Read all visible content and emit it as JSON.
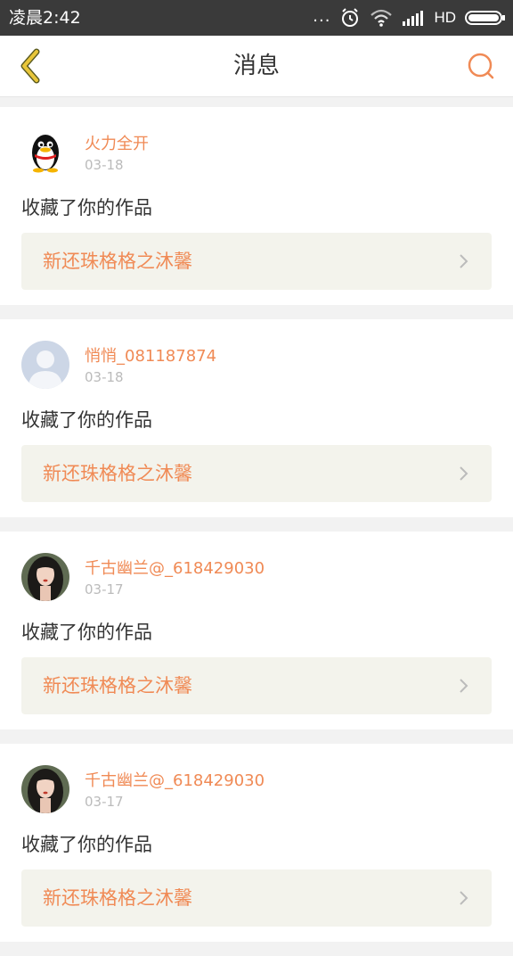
{
  "status_bar": {
    "time": "凌晨2:42",
    "dots": "...",
    "network": "HD",
    "icons": [
      "alarm-icon",
      "wifi-icon",
      "signal-icon",
      "battery-icon"
    ]
  },
  "nav": {
    "title": "消息",
    "back_icon": "chevron-left-icon",
    "search_icon": "search-icon",
    "accent_color": "#f08a55",
    "back_color": "#e8c63a"
  },
  "messages": [
    {
      "user": "火力全开",
      "date": "03-18",
      "action": "收藏了你的作品",
      "work": "新还珠格格之沐馨",
      "avatar": "penguin-avatar"
    },
    {
      "user": "悄悄_081187874",
      "date": "03-18",
      "action": "收藏了你的作品",
      "work": "新还珠格格之沐馨",
      "avatar": "default-avatar"
    },
    {
      "user": "千古幽兰@_618429030",
      "date": "03-17",
      "action": "收藏了你的作品",
      "work": "新还珠格格之沐馨",
      "avatar": "photo-avatar"
    },
    {
      "user": "千古幽兰@_618429030",
      "date": "03-17",
      "action": "收藏了你的作品",
      "work": "新还珠格格之沐馨",
      "avatar": "photo-avatar"
    }
  ]
}
